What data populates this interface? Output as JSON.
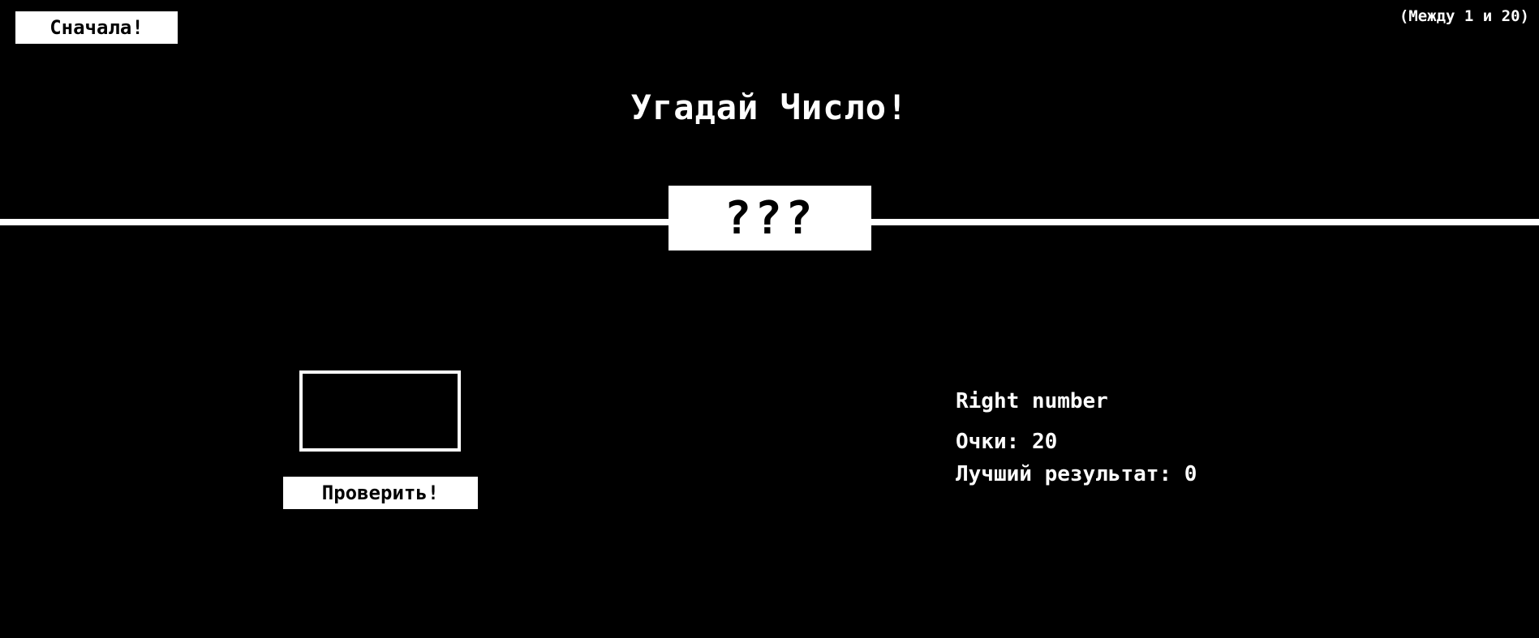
{
  "header": {
    "again_label": "Сначала!",
    "range_hint": "(Между 1 и 20)"
  },
  "title": "Угадай Число!",
  "secret_number": "???",
  "guess": {
    "value": "",
    "check_label": "Проверить!"
  },
  "stats": {
    "message": "Right number",
    "score_label": "Очки:",
    "score_value": "20",
    "highscore_label": "Лучший результат:",
    "highscore_value": "0"
  },
  "colors": {
    "background": "#000000",
    "foreground": "#ffffff"
  }
}
